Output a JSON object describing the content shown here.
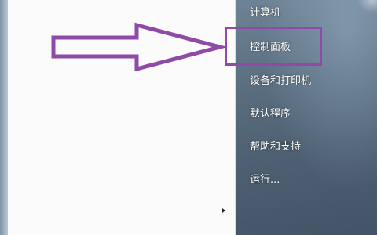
{
  "start_menu": {
    "right_items": [
      {
        "label": "计算机"
      },
      {
        "label": "控制面板"
      },
      {
        "label": "设备和打印机"
      },
      {
        "label": "默认程序"
      },
      {
        "label": "帮助和支持"
      },
      {
        "label": "运行..."
      }
    ],
    "highlighted_item": "控制面板"
  },
  "annotation": {
    "color": "#8e4aa6",
    "arrow_icon": "arrow-right-outline-icon"
  }
}
